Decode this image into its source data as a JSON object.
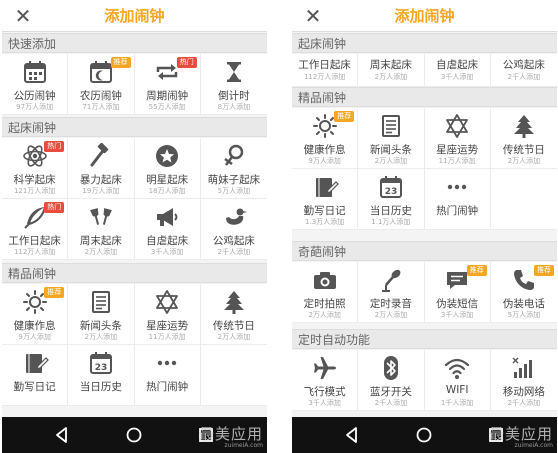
{
  "colors": {
    "accent": "#f5a623",
    "hot_badge": "#e84c3d",
    "icon_gray": "#555555",
    "nav_bg": "#111111"
  },
  "screens": [
    {
      "title": "添加闹钟",
      "close_icon": "close-icon",
      "watermark": {
        "main": "最美应用",
        "sub": "zuimeiA.com"
      },
      "sections": [
        {
          "header": "快速添加",
          "items": [
            {
              "label": "公历闹钟",
              "sub": "97万人添加",
              "icon": "calendar-icon"
            },
            {
              "label": "农历闹钟",
              "sub": "71万人添加",
              "icon": "lunar-calendar-icon",
              "badge": "推荐",
              "badge_type": "rec"
            },
            {
              "label": "周期闹钟",
              "sub": "55万人添加",
              "icon": "repeat-icon",
              "badge": "热门",
              "badge_type": "hot"
            },
            {
              "label": "倒计时",
              "sub": "8万人添加",
              "icon": "hourglass-icon"
            }
          ]
        },
        {
          "header": "起床闹钟",
          "items": [
            {
              "label": "科学起床",
              "sub": "121万人添加",
              "icon": "atom-icon",
              "badge": "热门",
              "badge_type": "hot"
            },
            {
              "label": "暴力起床",
              "sub": "19万人添加",
              "icon": "hammer-icon"
            },
            {
              "label": "明星起床",
              "sub": "18万人添加",
              "icon": "star-icon"
            },
            {
              "label": "萌妹子起床",
              "sub": "5万人添加",
              "icon": "female-icon"
            },
            {
              "label": "工作日起床",
              "sub": "112万人添加",
              "icon": "feather-icon",
              "badge": "热门",
              "badge_type": "hot"
            },
            {
              "label": "周末起床",
              "sub": "2万人添加",
              "icon": "cheers-icon"
            },
            {
              "label": "自虐起床",
              "sub": "3千人添加",
              "icon": "megaphone-icon"
            },
            {
              "label": "公鸡起床",
              "sub": "2千人添加",
              "icon": "bird-icon"
            }
          ]
        },
        {
          "header": "精品闹钟",
          "items": [
            {
              "label": "健康作息",
              "sub": "9万人添加",
              "icon": "sun-icon",
              "badge": "推荐",
              "badge_type": "rec"
            },
            {
              "label": "新闻头条",
              "sub": "2万人添加",
              "icon": "document-icon"
            },
            {
              "label": "星座运势",
              "sub": "11万人添加",
              "icon": "hexagram-icon"
            },
            {
              "label": "传统节日",
              "sub": "2万人添加",
              "icon": "pine-tree-icon"
            },
            {
              "label": "勤写日记",
              "sub": "",
              "icon": "diary-icon"
            },
            {
              "label": "当日历史",
              "sub": "",
              "icon": "date-23-icon"
            },
            {
              "label": "热门闹钟",
              "sub": "",
              "icon": "more-dots-icon"
            },
            {
              "label": "",
              "sub": "",
              "icon": ""
            }
          ]
        }
      ]
    },
    {
      "title": "添加闹钟",
      "close_icon": "close-icon",
      "watermark": {
        "main": "最美应用",
        "sub": "zuimeiA.com"
      },
      "sections": [
        {
          "header": "起床闹钟",
          "items": [
            {
              "label": "工作日起床",
              "sub": "112万人添加",
              "icon": ""
            },
            {
              "label": "周末起床",
              "sub": "2万人添加",
              "icon": ""
            },
            {
              "label": "自虐起床",
              "sub": "3千人添加",
              "icon": ""
            },
            {
              "label": "公鸡起床",
              "sub": "2千人添加",
              "icon": ""
            }
          ]
        },
        {
          "header": "精品闹钟",
          "items": [
            {
              "label": "健康作息",
              "sub": "9万人添加",
              "icon": "sun-icon",
              "badge": "推荐",
              "badge_type": "rec"
            },
            {
              "label": "新闻头条",
              "sub": "2万人添加",
              "icon": "document-icon"
            },
            {
              "label": "星座运势",
              "sub": "11万人添加",
              "icon": "hexagram-icon"
            },
            {
              "label": "传统节日",
              "sub": "2万人添加",
              "icon": "pine-tree-icon"
            },
            {
              "label": "勤写日记",
              "sub": "1.3万人添加",
              "icon": "diary-icon"
            },
            {
              "label": "当日历史",
              "sub": "1.1万人添加",
              "icon": "date-23-icon"
            },
            {
              "label": "热门闹钟",
              "sub": "",
              "icon": "more-dots-icon"
            },
            {
              "label": "",
              "sub": "",
              "icon": ""
            }
          ]
        },
        {
          "header": "奇葩闹钟",
          "items": [
            {
              "label": "定时拍照",
              "sub": "2万人添加",
              "icon": "camera-icon"
            },
            {
              "label": "定时录音",
              "sub": "2万人添加",
              "icon": "microphone-icon"
            },
            {
              "label": "伪装短信",
              "sub": "3千人添加",
              "icon": "chat-bubble-icon",
              "badge": "推荐",
              "badge_type": "rec"
            },
            {
              "label": "伪装电话",
              "sub": "5万人添加",
              "icon": "phone-icon",
              "badge": "推荐",
              "badge_type": "rec"
            }
          ]
        },
        {
          "header": "定时自动功能",
          "items": [
            {
              "label": "飞行模式",
              "sub": "3千人添加",
              "icon": "airplane-icon"
            },
            {
              "label": "蓝牙开关",
              "sub": "2千人添加",
              "icon": "bluetooth-icon"
            },
            {
              "label": "WIFI",
              "sub": "1千人添加",
              "icon": "wifi-icon"
            },
            {
              "label": "移动网络",
              "sub": "2千人添加",
              "icon": "signal-icon"
            }
          ]
        }
      ]
    }
  ]
}
